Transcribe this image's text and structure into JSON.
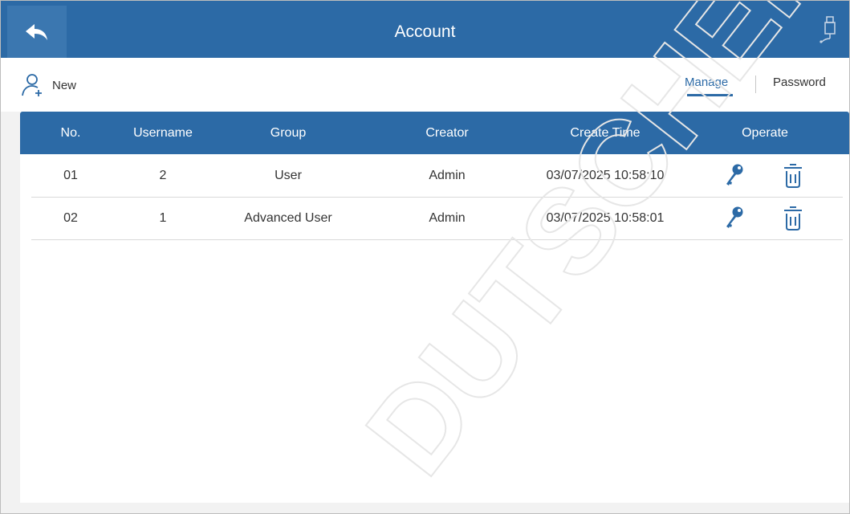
{
  "header": {
    "title": "Account",
    "back_icon": "back-arrow-icon",
    "usb_icon": "usb-icon",
    "color": "#2c6aa6"
  },
  "toolbar": {
    "new_label": "New",
    "new_icon": "add-user-icon",
    "tabs": [
      {
        "label": "Manage",
        "active": true
      },
      {
        "label": "Password",
        "active": false
      }
    ]
  },
  "table": {
    "columns": [
      "No.",
      "Username",
      "Group",
      "Creator",
      "Create Time",
      "Operate"
    ],
    "rows": [
      {
        "no": "01",
        "username": "2",
        "group": "User",
        "creator": "Admin",
        "create_time": "03/07/2025 10:58:10"
      },
      {
        "no": "02",
        "username": "1",
        "group": "Advanced User",
        "creator": "Admin",
        "create_time": "03/07/2025 10:58:01"
      }
    ],
    "operate_icons": [
      "key-icon",
      "trash-icon"
    ]
  },
  "watermark": {
    "text": "DUTSCHER SA"
  }
}
